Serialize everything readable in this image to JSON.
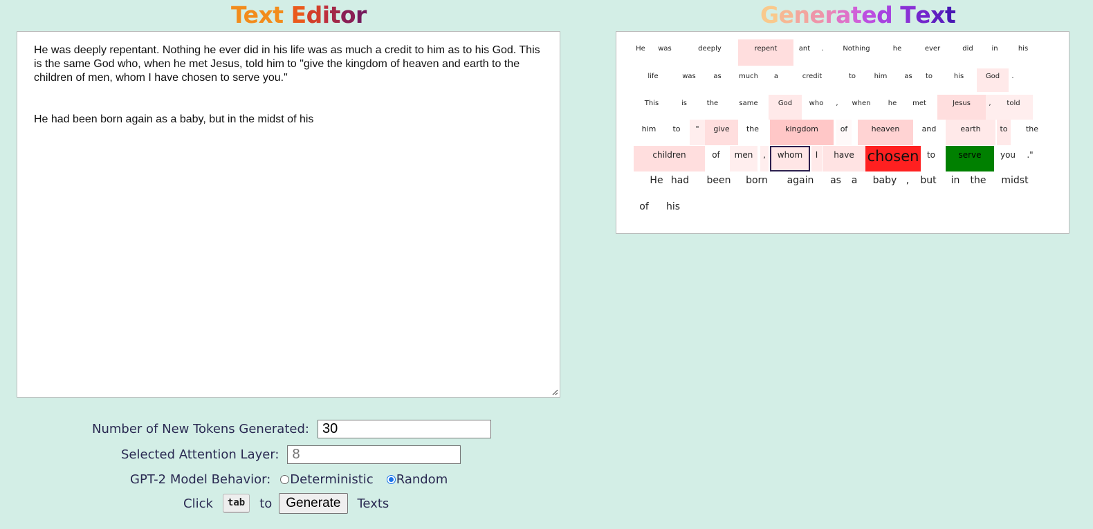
{
  "editor": {
    "title_parts": [
      {
        "text": "Text",
        "color": "#f28c1c"
      },
      {
        "text": " ",
        "color": "#000000"
      },
      {
        "text": "E",
        "color": "#ea5a1c"
      },
      {
        "text": "d",
        "color": "#d23f2a"
      },
      {
        "text": "i",
        "color": "#bd2f3d"
      },
      {
        "text": "t",
        "color": "#a22848"
      },
      {
        "text": "o",
        "color": "#8a1f55"
      },
      {
        "text": "r",
        "color": "#761a5c"
      }
    ],
    "content": "He was deeply repentant. Nothing he ever did in his life was as much a credit to him as to his God. This is the same God who, when he met Jesus, told him to \"give the kingdom of heaven and earth to the children of men, whom I have chosen to serve you.\"\n\n\nHe had been born again as a baby, but in the midst of his"
  },
  "generated": {
    "title_parts": [
      {
        "text": "G",
        "color": "#f9c98c"
      },
      {
        "text": "e",
        "color": "#f6b894"
      },
      {
        "text": "n",
        "color": "#f2a69e"
      },
      {
        "text": "e",
        "color": "#ee95a9"
      },
      {
        "text": "r",
        "color": "#e985b8"
      },
      {
        "text": "a",
        "color": "#df72c8"
      },
      {
        "text": "t",
        "color": "#d060d8"
      },
      {
        "text": "e",
        "color": "#bc4fe0"
      },
      {
        "text": "d",
        "color": "#a742e0"
      },
      {
        "text": " ",
        "color": "#000000"
      },
      {
        "text": "T",
        "color": "#8a31d6"
      },
      {
        "text": "e",
        "color": "#7326cc"
      },
      {
        "text": "x",
        "color": "#5e1fc0"
      },
      {
        "text": "t",
        "color": "#4a18b4"
      }
    ],
    "tokens": [
      [
        "He",
        "was",
        "deeply",
        "repent",
        "ant",
        ".",
        "Nothing",
        "he",
        "ever",
        "did",
        "in",
        "his"
      ],
      [
        "life",
        "was",
        "as",
        "much",
        "a",
        "credit",
        "to",
        "him",
        "as",
        "to",
        "his",
        "God",
        "."
      ],
      [
        "This",
        "is",
        "the",
        "same",
        "God",
        "who",
        ",",
        "when",
        "he",
        "met",
        "Jesus",
        ",",
        "told"
      ],
      [
        "him",
        "to",
        "\"",
        "give",
        "the",
        "kingdom",
        "of",
        "heaven",
        "and",
        "earth",
        "to",
        "the"
      ],
      [
        "children",
        "of",
        "men",
        ",",
        "whom",
        "I",
        "have",
        "chosen",
        "to",
        "serve",
        "you",
        ".\""
      ],
      [
        "He",
        "had",
        "been",
        "born",
        "again",
        "as",
        "a",
        "baby",
        ",",
        "but",
        "in",
        "the",
        "midst"
      ],
      [
        "of",
        "his"
      ]
    ],
    "attention": [
      [
        0,
        0,
        0,
        0.3,
        0,
        0,
        0,
        0,
        0,
        0,
        0,
        0
      ],
      [
        0,
        0,
        0,
        0,
        0,
        0,
        0,
        0,
        0,
        0,
        0,
        0.2,
        0
      ],
      [
        0,
        0,
        0,
        0,
        0.2,
        0,
        0,
        0,
        0,
        0,
        0.3,
        0.15,
        0.15
      ],
      [
        0,
        0,
        0.15,
        0.3,
        0,
        0.5,
        0.05,
        0.4,
        0,
        0.2,
        0.2,
        0
      ],
      [
        0.3,
        0,
        0.15,
        0.15,
        0,
        0.2,
        0.25,
        1.0,
        0,
        0,
        0,
        0
      ],
      [
        0,
        0,
        0,
        0,
        0,
        0,
        0,
        0,
        0,
        0,
        0,
        0,
        0
      ],
      [
        0,
        0
      ]
    ],
    "selected_token": "whom",
    "predicted_token": "serve",
    "predicted_color": "#008000",
    "highlight_color": "#ff2020"
  },
  "controls": {
    "tokens_label": "Number of New Tokens Generated:",
    "tokens_value": "30",
    "layer_label": "Selected Attention Layer:",
    "layer_placeholder": "8",
    "behavior_label": "GPT-2 Model Behavior:",
    "behavior_options": [
      "Deterministic",
      "Random"
    ],
    "behavior_selected": "Random",
    "click_label": "Click",
    "key_label": "tab",
    "to_label": "to",
    "generate_label": "Generate",
    "texts_label": "Texts"
  }
}
